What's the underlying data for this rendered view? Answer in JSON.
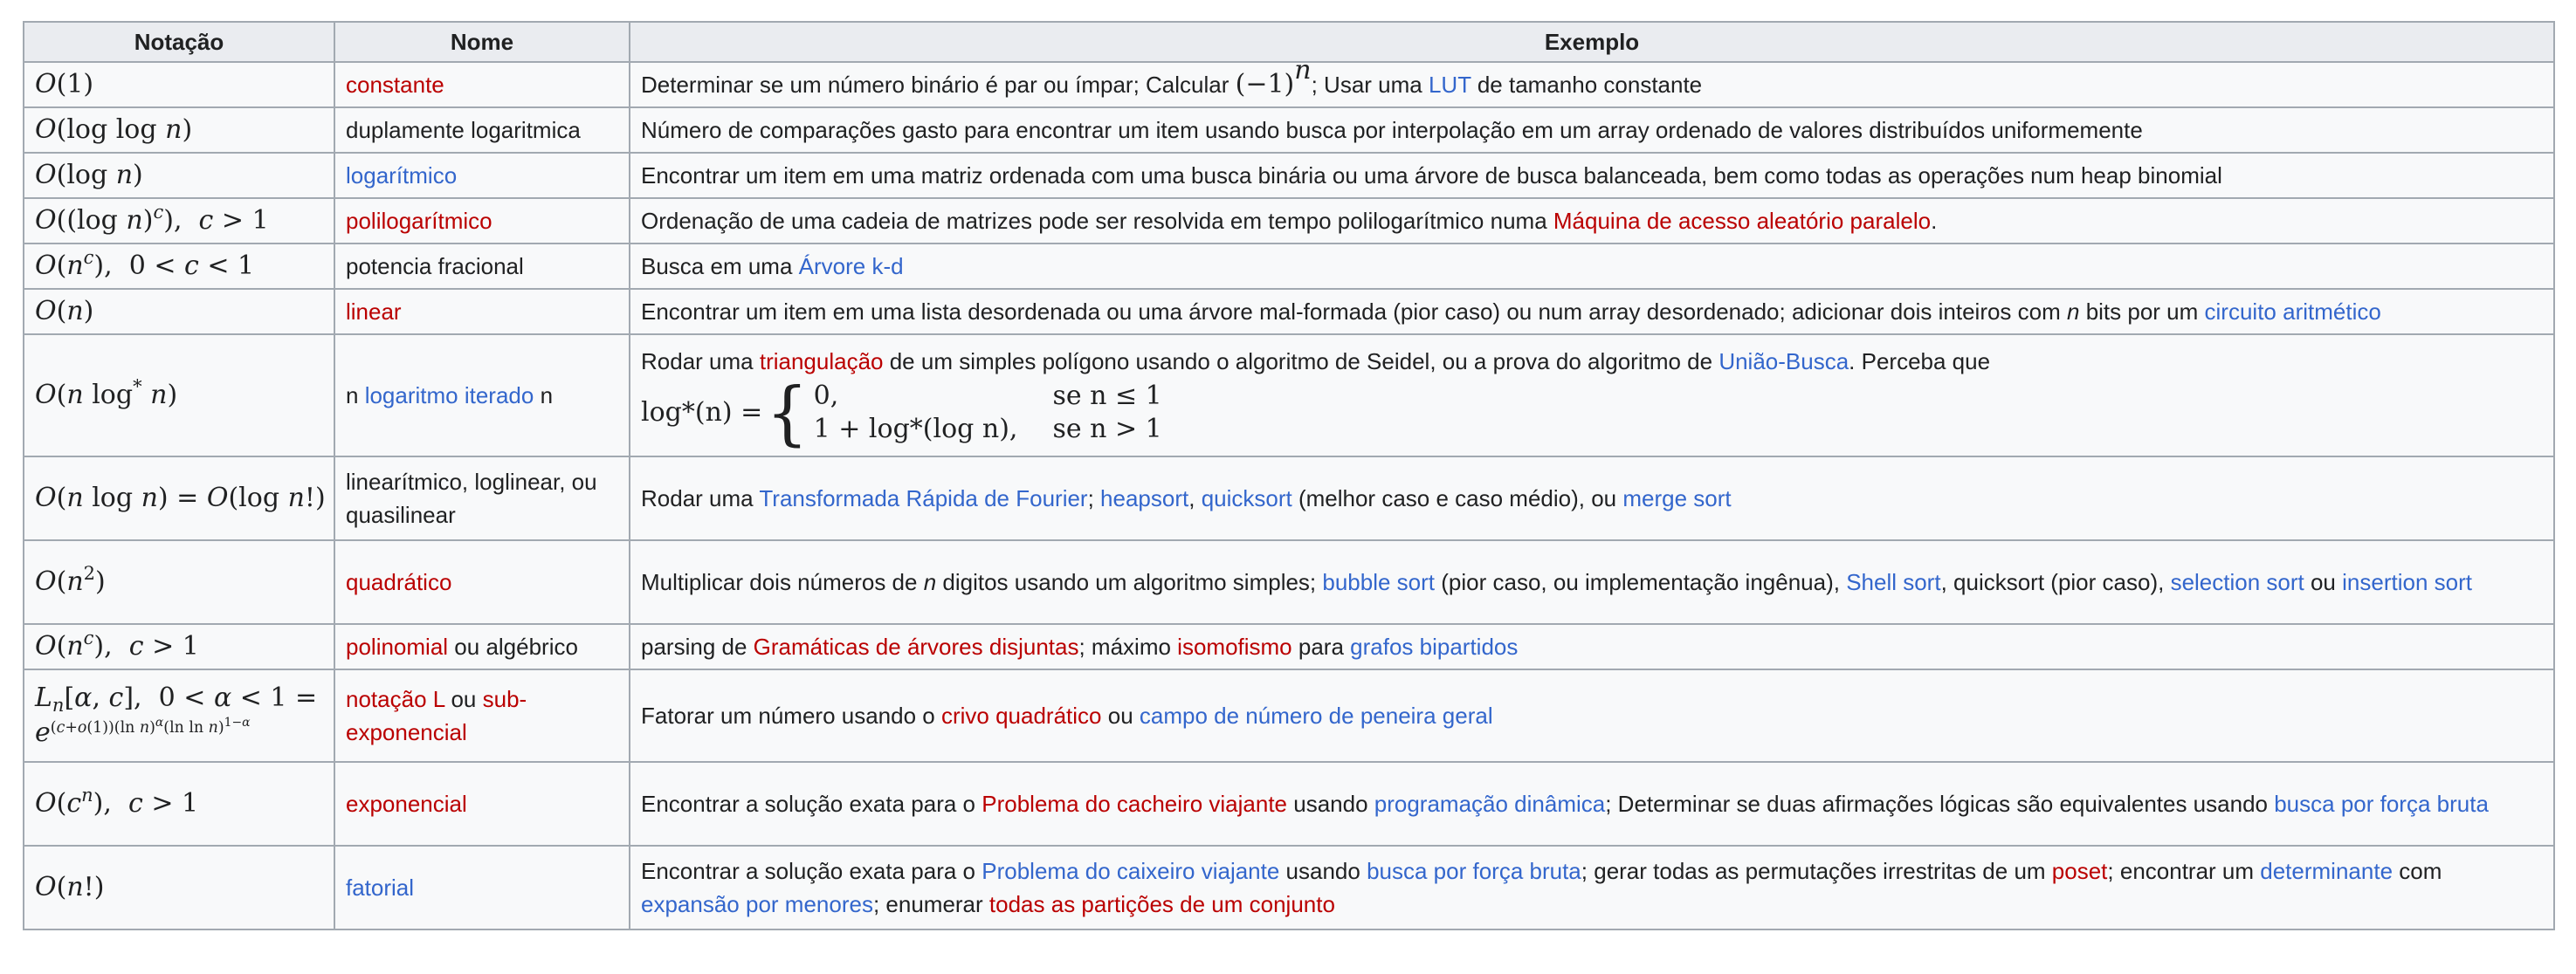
{
  "headers": {
    "notation": "Notação",
    "name": "Nome",
    "example": "Exemplo"
  },
  "rows": [
    {
      "notation": "O(1)",
      "name": [
        {
          "t": "constante",
          "c": "red"
        }
      ],
      "example": [
        {
          "t": "Determinar se um número binário é par ou ímpar; Calcular "
        },
        {
          "t": "(−1)",
          "m": "1"
        },
        {
          "t": "n",
          "m": "sup"
        },
        {
          "t": "; Usar uma "
        },
        {
          "t": "LUT",
          "c": "blue"
        },
        {
          "t": " de tamanho constante"
        }
      ]
    },
    {
      "notation": "O(log log n)",
      "name": [
        {
          "t": "duplamente logaritmica"
        }
      ],
      "example": [
        {
          "t": "Número de comparações gasto para encontrar um item usando busca por interpolação em um array ordenado de valores distribuídos uniformemente"
        }
      ]
    },
    {
      "notation": "O(log n)",
      "name": [
        {
          "t": "logarítmico",
          "c": "blue"
        }
      ],
      "example": [
        {
          "t": "Encontrar um item em uma matriz ordenada com uma busca binária ou uma árvore de busca balanceada, bem como todas as operações num heap binomial"
        }
      ]
    },
    {
      "notation": "O((log n)^c), c > 1",
      "name": [
        {
          "t": "polilogarítmico",
          "c": "red"
        }
      ],
      "example": [
        {
          "t": "Ordenação de uma cadeia de matrizes pode ser resolvida em tempo polilogarítmico numa "
        },
        {
          "t": "Máquina de acesso aleatório paralelo",
          "c": "red"
        },
        {
          "t": "."
        }
      ]
    },
    {
      "notation": "O(n^c), 0 < c < 1",
      "name": [
        {
          "t": "potencia fracional"
        }
      ],
      "example": [
        {
          "t": "Busca em uma "
        },
        {
          "t": "Árvore k-d",
          "c": "blue"
        }
      ]
    },
    {
      "notation": "O(n)",
      "name": [
        {
          "t": "linear",
          "c": "red"
        }
      ],
      "example": [
        {
          "t": "Encontrar um item em uma lista desordenada ou uma árvore mal-formada (pior caso) ou num array desordenado; adicionar dois inteiros com "
        },
        {
          "t": "n",
          "i": "1"
        },
        {
          "t": " bits por um "
        },
        {
          "t": "circuito aritmético",
          "c": "blue"
        }
      ]
    },
    {
      "notation": "O(n log* n)",
      "name": [
        {
          "t": "n "
        },
        {
          "t": "logaritmo iterado",
          "c": "blue"
        },
        {
          "t": " n"
        }
      ],
      "example": [
        {
          "t": "Rodar uma "
        },
        {
          "t": "triangulação",
          "c": "red"
        },
        {
          "t": " de um simples polígono usando o algoritmo de Seidel, ou a prova do algoritmo de "
        },
        {
          "t": "União-Busca",
          "c": "blue"
        },
        {
          "t": ". Perceba que"
        }
      ],
      "formula": {
        "lhs": "log*(n) =",
        "r1a": "0,",
        "r1b": "se n ≤ 1",
        "r2a": "1 + log*(log n),",
        "r2b": "se n > 1"
      }
    },
    {
      "notation": "O(n log n) = O(log n!)",
      "name": [
        {
          "t": "linearítmico, loglinear, ou quasilinear"
        }
      ],
      "example": [
        {
          "t": "Rodar uma "
        },
        {
          "t": "Transformada Rápida de Fourier",
          "c": "blue"
        },
        {
          "t": "; "
        },
        {
          "t": "heapsort",
          "c": "blue"
        },
        {
          "t": ", "
        },
        {
          "t": "quicksort",
          "c": "blue"
        },
        {
          "t": " (melhor caso e caso médio), ou "
        },
        {
          "t": "merge sort",
          "c": "blue"
        }
      ]
    },
    {
      "notation": "O(n^2)",
      "name": [
        {
          "t": "quadrático",
          "c": "red"
        }
      ],
      "example": [
        {
          "t": "Multiplicar dois números de "
        },
        {
          "t": "n",
          "i": "1"
        },
        {
          "t": " digitos usando um algoritmo simples; "
        },
        {
          "t": "bubble sort",
          "c": "blue"
        },
        {
          "t": " (pior caso, ou implementação ingênua), "
        },
        {
          "t": "Shell sort",
          "c": "blue"
        },
        {
          "t": ", quicksort (pior caso), "
        },
        {
          "t": "selection sort",
          "c": "blue"
        },
        {
          "t": " ou "
        },
        {
          "t": "insertion sort",
          "c": "blue"
        }
      ]
    },
    {
      "notation": "O(n^c), c > 1",
      "name": [
        {
          "t": "polinomial",
          "c": "red"
        },
        {
          "t": " ou algébrico"
        }
      ],
      "example": [
        {
          "t": "parsing de "
        },
        {
          "t": "Gramáticas de árvores disjuntas",
          "c": "red"
        },
        {
          "t": "; máximo "
        },
        {
          "t": "isomofismo",
          "c": "red"
        },
        {
          "t": " para "
        },
        {
          "t": "grafos bipartidos",
          "c": "blue"
        }
      ]
    },
    {
      "notation": "L_n[α, c], 0 < α < 1 = e^((c+o(1))(ln n)^α (ln ln n)^(1−α))",
      "name": [
        {
          "t": "notação L",
          "c": "red"
        },
        {
          "t": " ou "
        },
        {
          "t": "sub-exponencial",
          "c": "red"
        }
      ],
      "example": [
        {
          "t": "Fatorar um número usando o "
        },
        {
          "t": "crivo quadrático",
          "c": "red"
        },
        {
          "t": " ou "
        },
        {
          "t": "campo de número de peneira geral",
          "c": "blue"
        }
      ]
    },
    {
      "notation": "O(c^n), c > 1",
      "name": [
        {
          "t": "exponencial",
          "c": "red"
        }
      ],
      "example": [
        {
          "t": "Encontrar a solução exata para o "
        },
        {
          "t": "Problema do cacheiro viajante",
          "c": "red"
        },
        {
          "t": " usando "
        },
        {
          "t": "programação dinâmica",
          "c": "blue"
        },
        {
          "t": "; Determinar se duas afirmações lógicas são equivalentes usando "
        },
        {
          "t": "busca por força bruta",
          "c": "blue"
        }
      ]
    },
    {
      "notation": "O(n!)",
      "name": [
        {
          "t": "fatorial",
          "c": "blue"
        }
      ],
      "example": [
        {
          "t": "Encontrar a solução exata para o "
        },
        {
          "t": "Problema do caixeiro viajante",
          "c": "blue"
        },
        {
          "t": " usando "
        },
        {
          "t": "busca por força bruta",
          "c": "blue"
        },
        {
          "t": "; gerar todas as permutações irrestritas de um "
        },
        {
          "t": "poset",
          "c": "red"
        },
        {
          "t": "; encontrar um "
        },
        {
          "t": "determinante",
          "c": "blue"
        },
        {
          "t": " com "
        },
        {
          "t": "expansão por menores",
          "c": "blue"
        },
        {
          "t": "; enumerar "
        },
        {
          "t": "todas as partições de um conjunto",
          "c": "red"
        }
      ]
    }
  ],
  "colors": {
    "link_blue": "#3366cc",
    "link_red": "#ba0000",
    "header_bg": "#eaecf0",
    "border": "#a2a9b1",
    "cell_bg": "#f8f9fa"
  }
}
